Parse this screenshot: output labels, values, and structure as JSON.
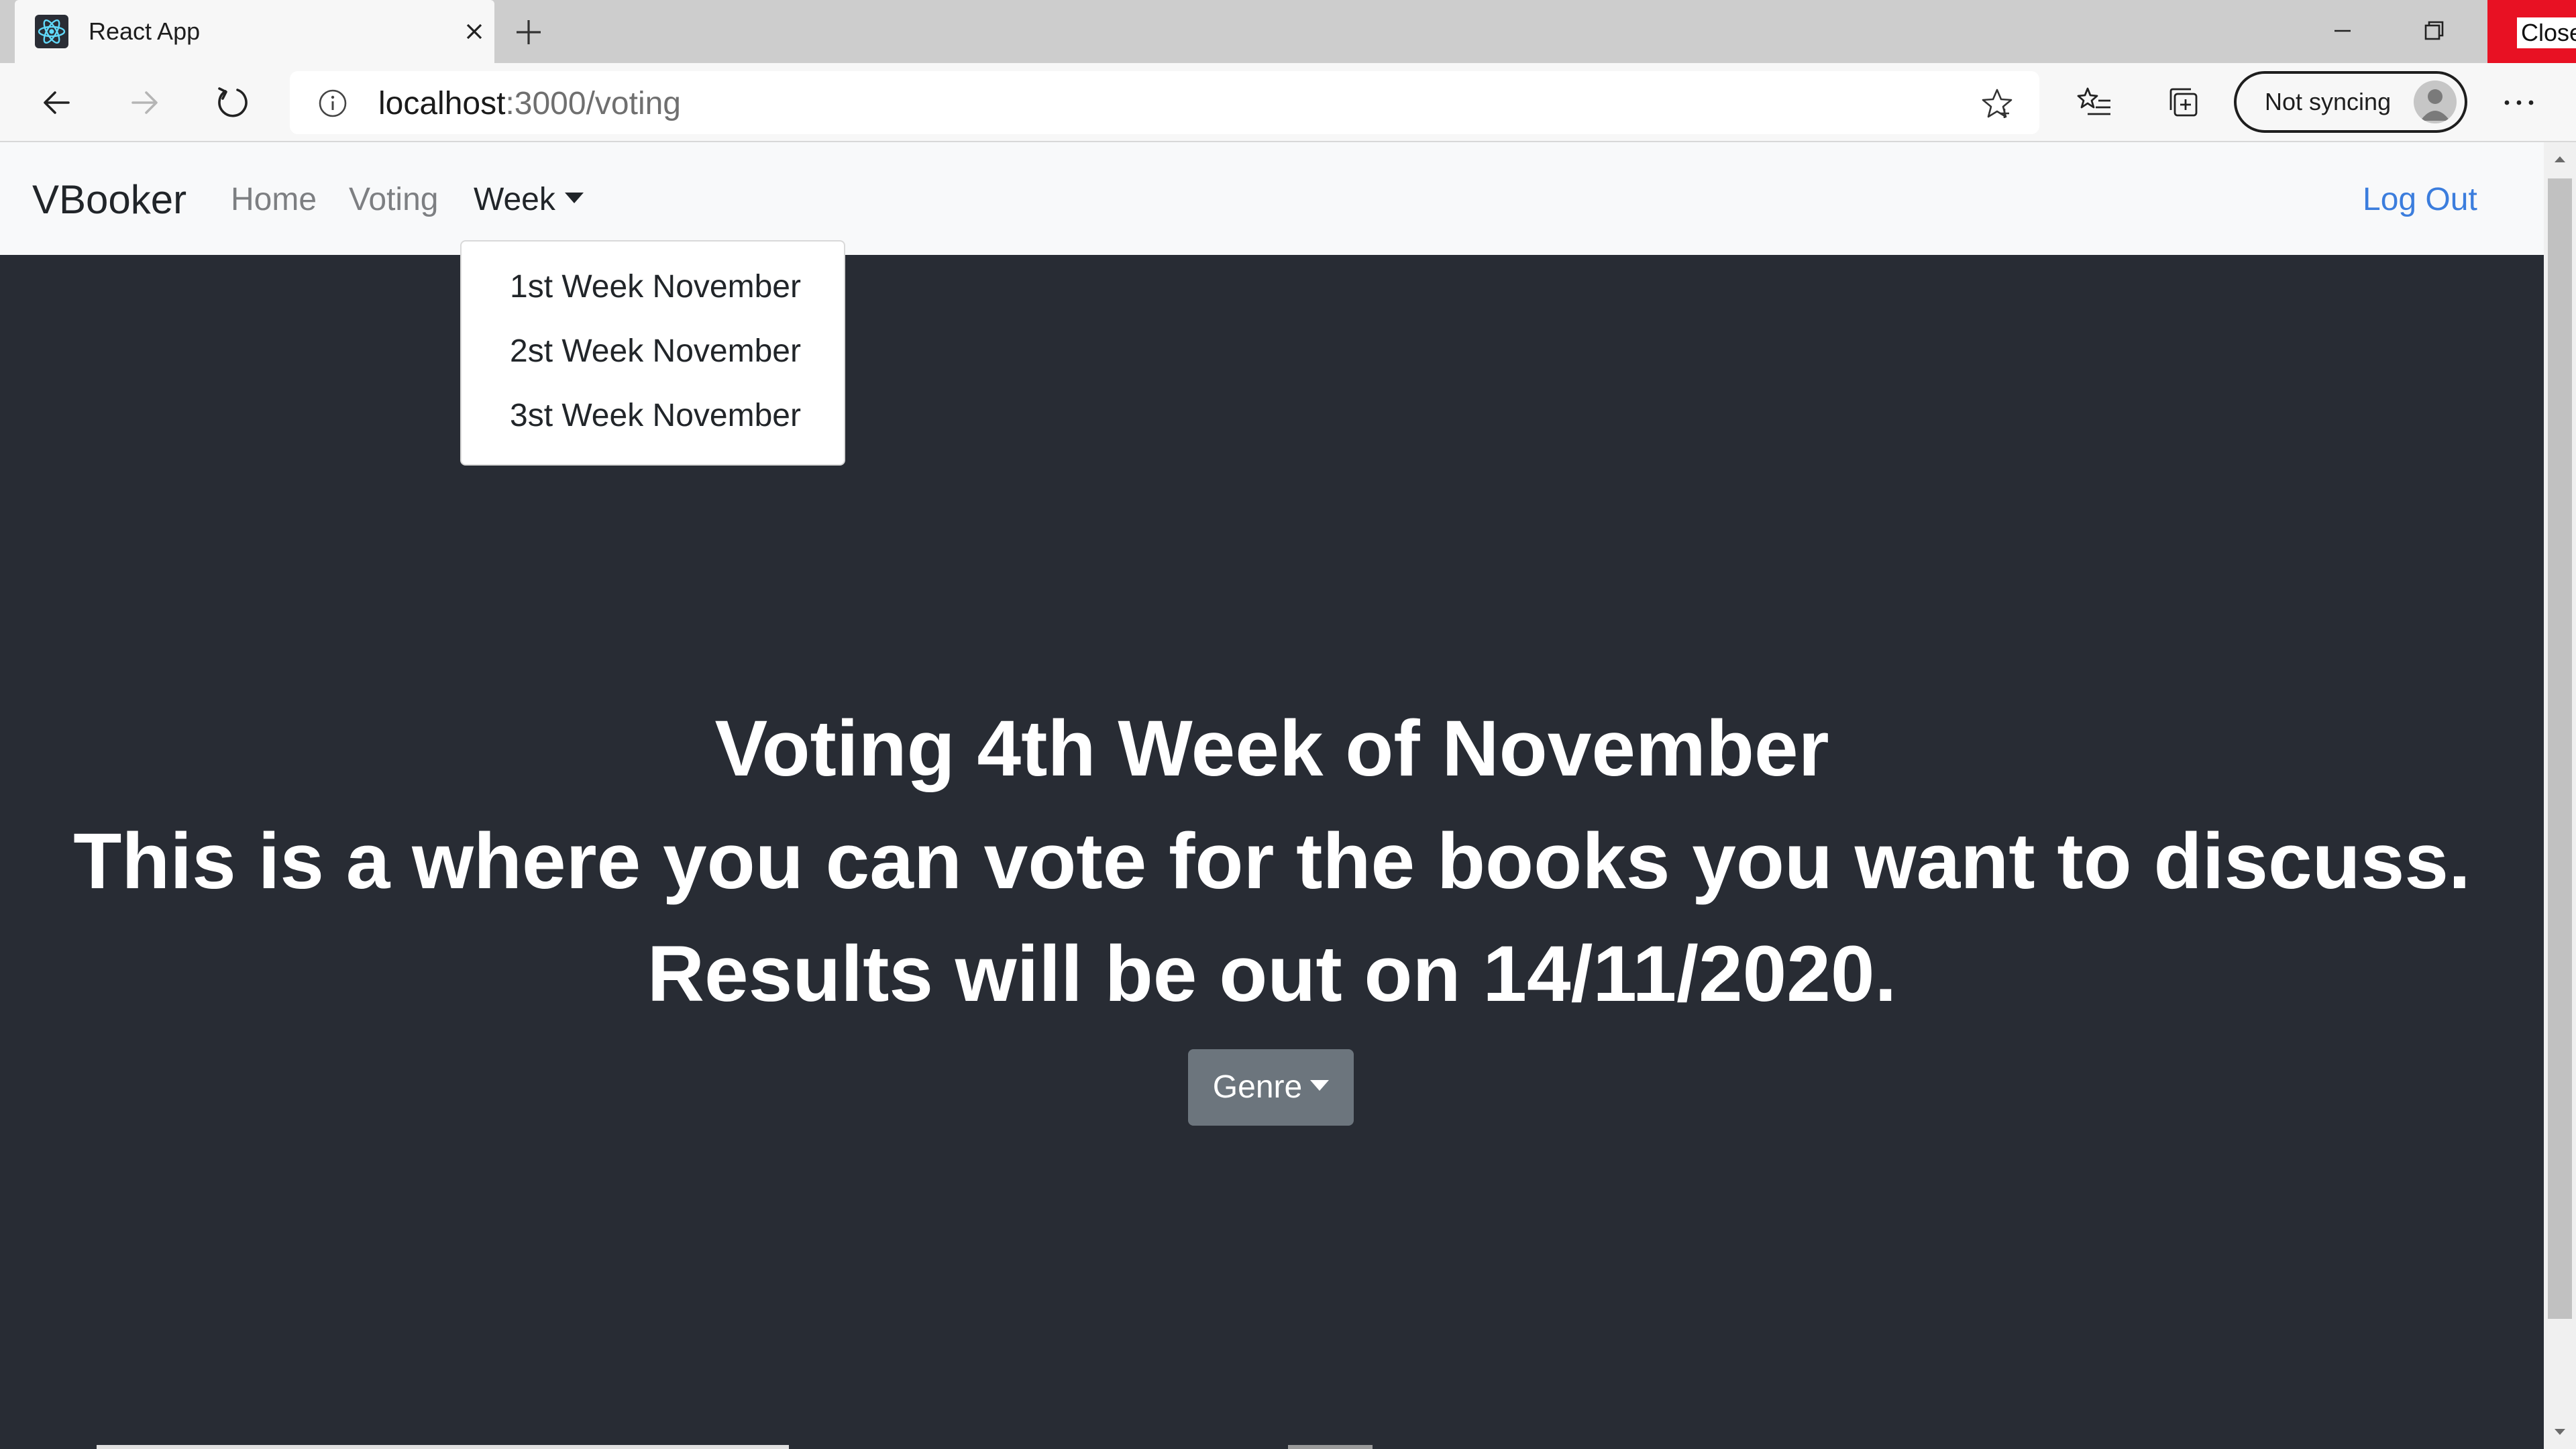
{
  "browser": {
    "tab_title": "React App",
    "url_host": "localhost",
    "url_path": ":3000/voting",
    "sync_label": "Not syncing",
    "close_label": "Close",
    "icons": [
      "react-favicon-icon",
      "close-tab-icon",
      "new-tab-icon",
      "minimize-icon",
      "restore-icon",
      "back-icon",
      "forward-icon",
      "refresh-icon",
      "info-icon",
      "favorite-star-icon",
      "favorites-icon",
      "collections-icon",
      "profile-avatar-icon",
      "more-icon"
    ]
  },
  "navbar": {
    "brand": "VBooker",
    "links": [
      "Home",
      "Voting"
    ],
    "week_label": "Week",
    "logout": "Log Out"
  },
  "week_dropdown": {
    "items": [
      "1st Week November",
      "2st Week November",
      "3st Week November"
    ]
  },
  "hero": {
    "title": "Voting 4th Week of November",
    "line2": "This is a where you can vote for the books you want to discuss.",
    "line3": "Results will be out on 14/11/2020."
  },
  "genre_button": "Genre",
  "colors": {
    "background": "#282c34",
    "navbar": "#f8f9fa",
    "link_accent": "#3b7ddd",
    "button": "#6c757d",
    "close_red": "#e81123"
  }
}
